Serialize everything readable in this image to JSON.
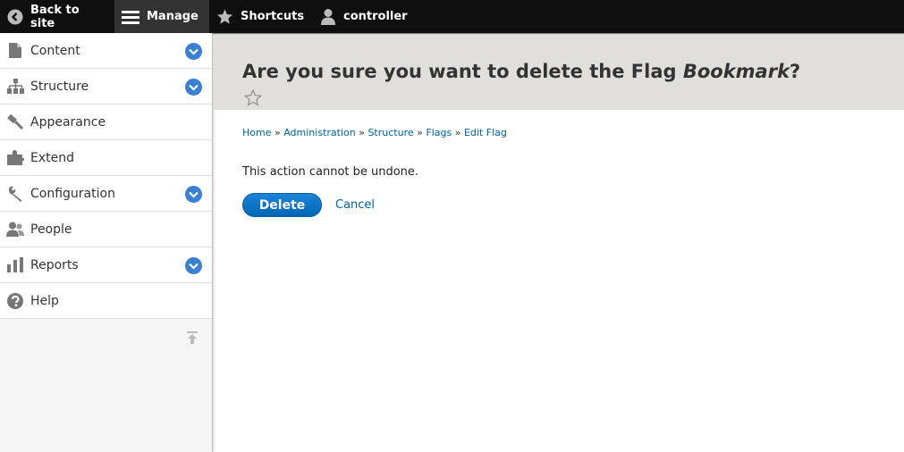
{
  "toolbar": {
    "back_label": "Back to site",
    "manage_label": "Manage",
    "shortcuts_label": "Shortcuts",
    "user_label": "controller"
  },
  "sidebar": {
    "items": [
      {
        "label": "Content",
        "icon": "file-icon",
        "expandable": true
      },
      {
        "label": "Structure",
        "icon": "sitemap-icon",
        "expandable": true
      },
      {
        "label": "Appearance",
        "icon": "paintbrush-icon",
        "expandable": false
      },
      {
        "label": "Extend",
        "icon": "puzzle-icon",
        "expandable": false
      },
      {
        "label": "Configuration",
        "icon": "wrench-icon",
        "expandable": true
      },
      {
        "label": "People",
        "icon": "people-icon",
        "expandable": false
      },
      {
        "label": "Reports",
        "icon": "bar-chart-icon",
        "expandable": true
      },
      {
        "label": "Help",
        "icon": "help-icon",
        "expandable": false
      }
    ]
  },
  "page": {
    "title_prefix": "Are you sure you want to delete the Flag ",
    "title_emphasis": "Bookmark",
    "title_suffix": "?"
  },
  "breadcrumb": {
    "items": [
      "Home",
      "Administration",
      "Structure",
      "Flags",
      "Edit Flag"
    ],
    "separator": "»"
  },
  "message": "This action cannot be undone.",
  "actions": {
    "delete_label": "Delete",
    "cancel_label": "Cancel"
  },
  "colors": {
    "toolbar_bg": "#0f0f0f",
    "accent": "#0066b4",
    "link": "#0060a6",
    "header_bg": "#e0dfdb"
  }
}
